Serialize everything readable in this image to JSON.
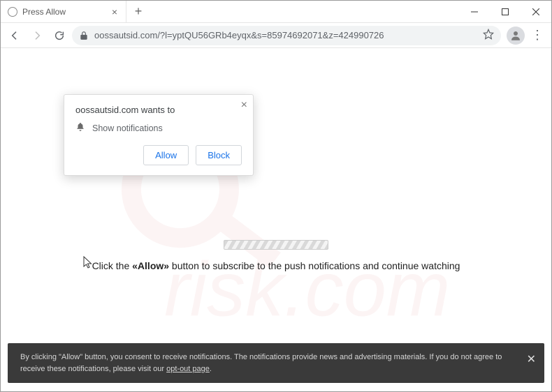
{
  "tab": {
    "title": "Press Allow"
  },
  "url": "oossautsid.com/?l=yptQU56GRb4eyqx&s=85974692071&z=424990726",
  "permission": {
    "site_wants": "oossautsid.com wants to",
    "show_notifications": "Show notifications",
    "allow": "Allow",
    "block": "Block"
  },
  "page": {
    "prefix": "Click the ",
    "bold": "«Allow»",
    "suffix": " button to subscribe to the push notifications and continue watching"
  },
  "consent": {
    "line": "By clicking \"Allow\" button, you consent to receive notifications. The notifications provide news and advertising materials. If you do not agree to receive these notifications, please visit our ",
    "link": "opt-out page",
    "tail": "."
  }
}
